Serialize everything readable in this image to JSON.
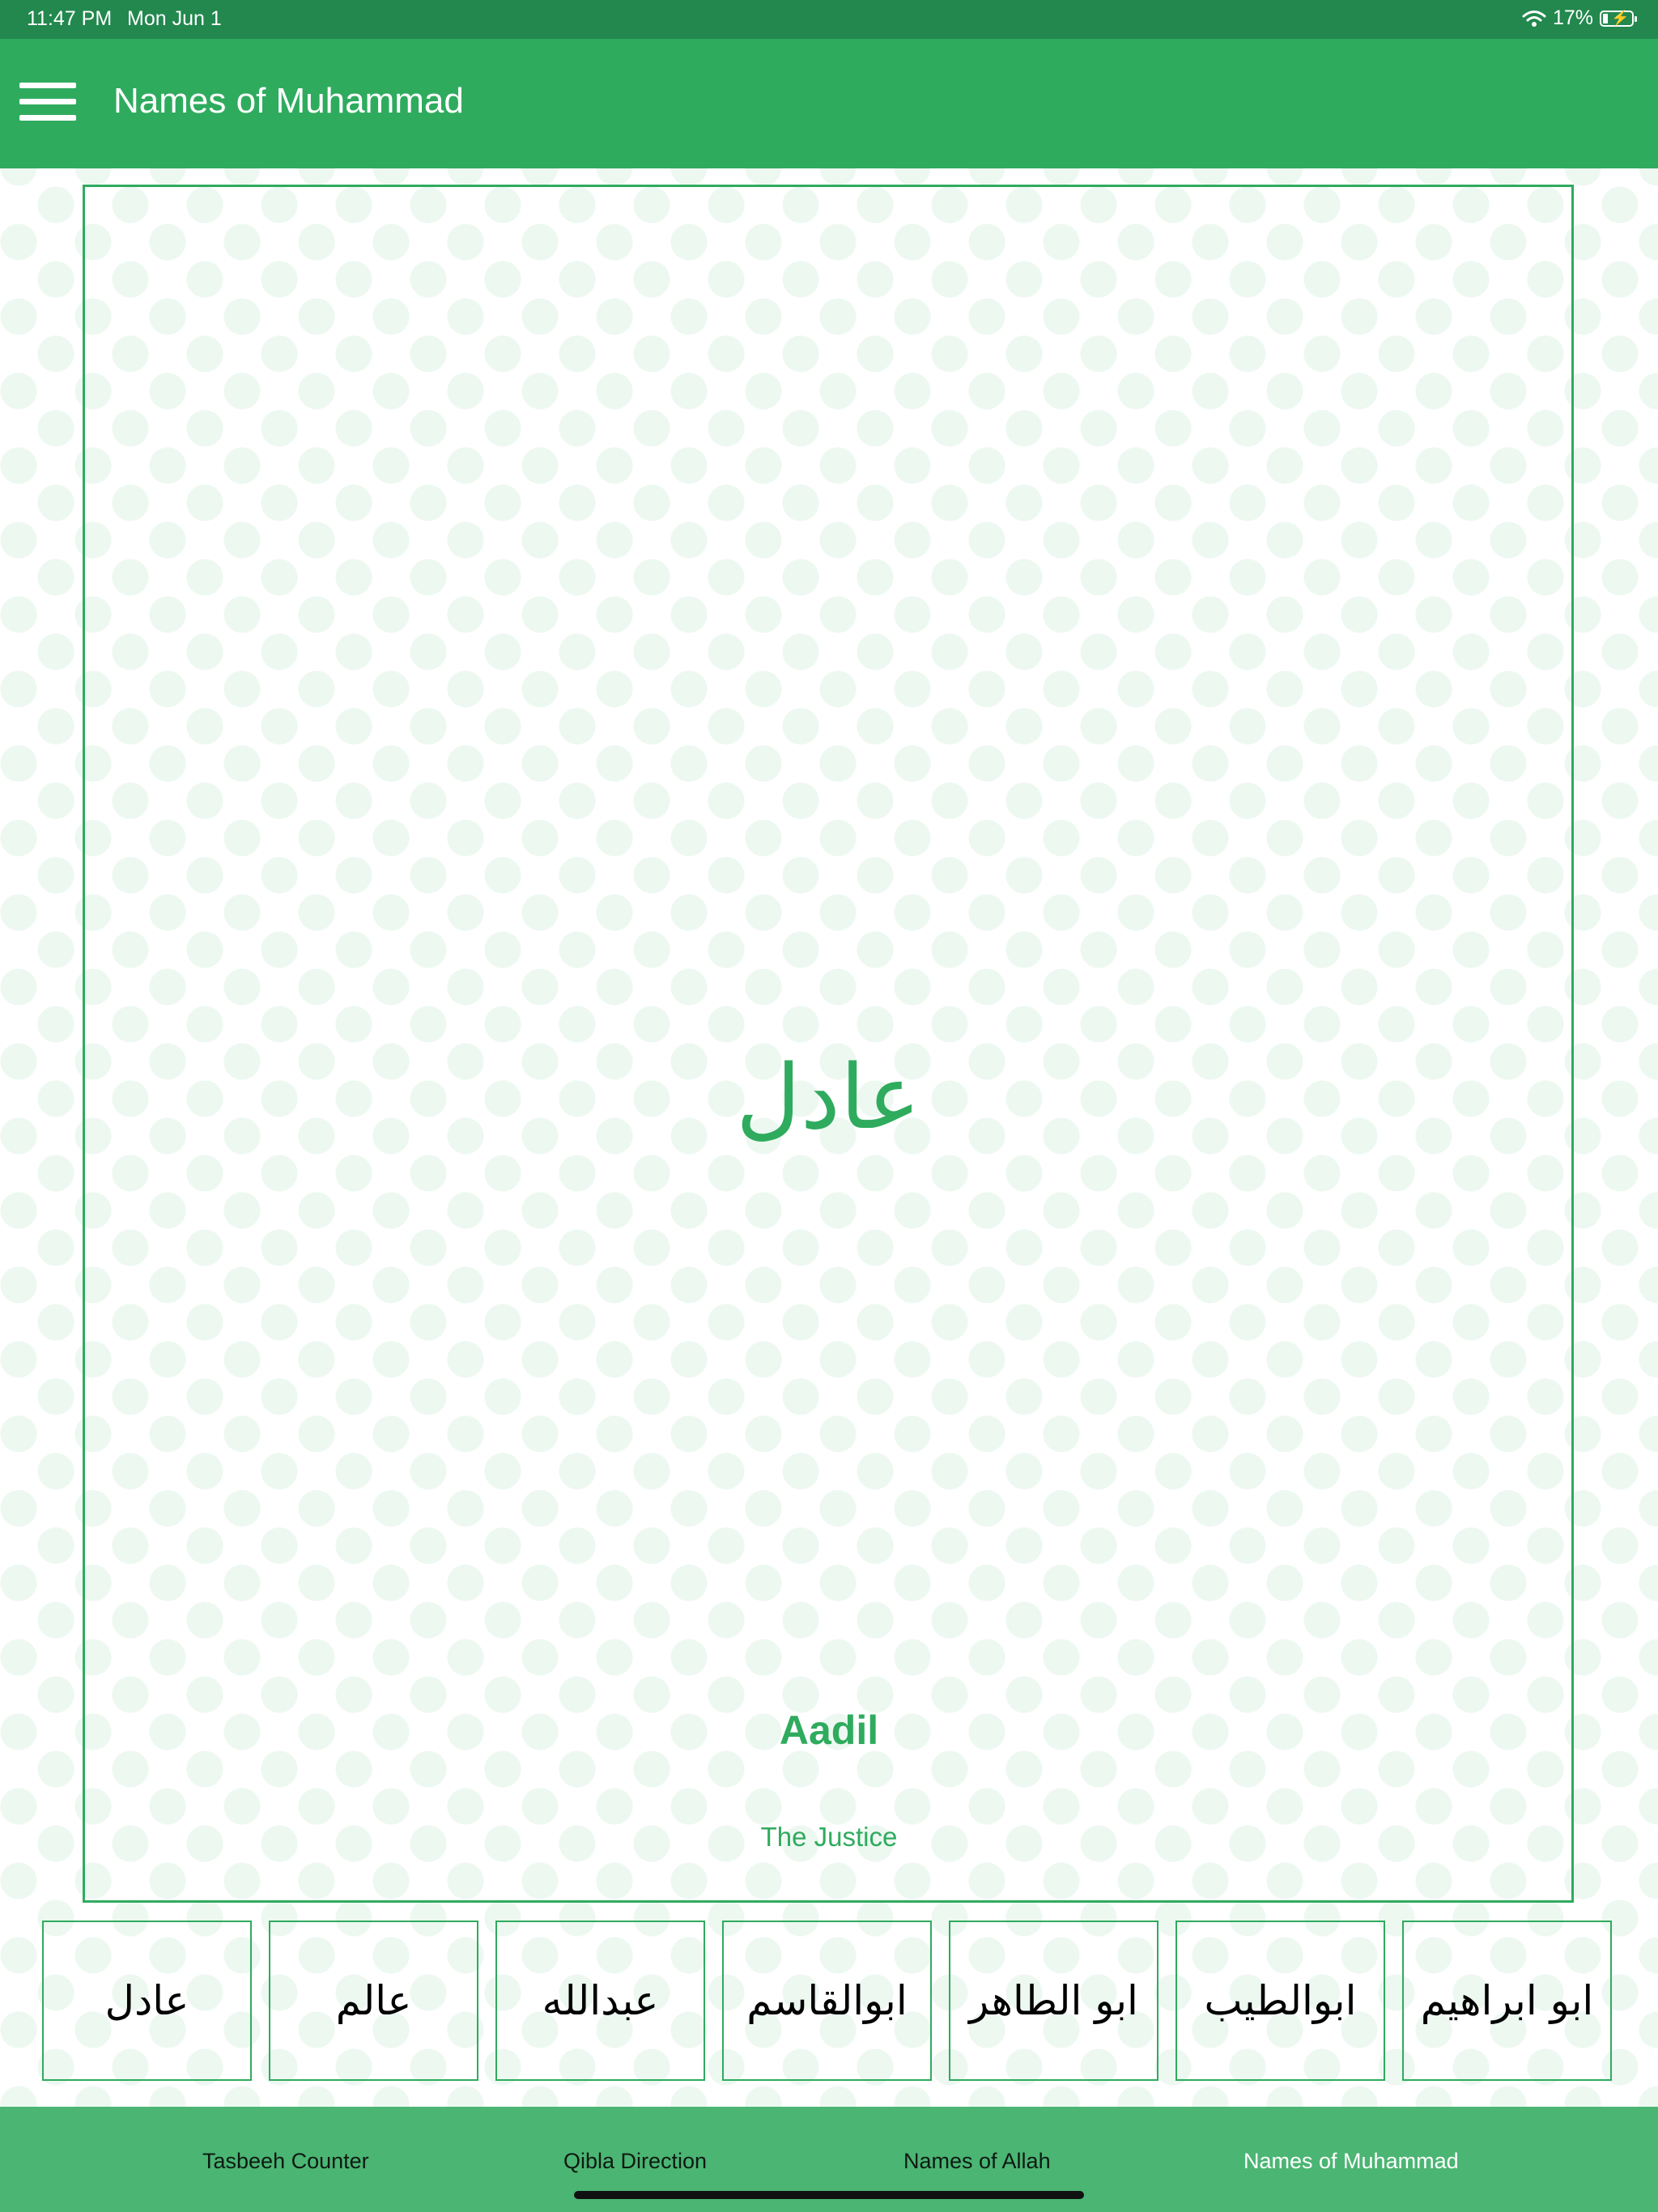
{
  "status_bar": {
    "time": "11:47 PM",
    "date": "Mon Jun 1",
    "battery_text": "17%",
    "battery_level": 0.17,
    "wifi_icon": "wifi-icon",
    "battery_icon": "battery-charging-icon"
  },
  "app_bar": {
    "title": "Names of Muhammad",
    "menu_icon": "hamburger-menu-icon"
  },
  "colors": {
    "primary": "#2fab5e",
    "status_bar": "#22884e",
    "tab_bar": "#4bb573"
  },
  "selected_name": {
    "arabic": "عادل",
    "transliteration": "Aadil",
    "meaning": "The Justice"
  },
  "name_list": [
    "عادل",
    "عالم",
    "عبدالله",
    "ابوالقاسم",
    "ابو الطاهر",
    "ابوالطیب",
    "ابو ابراهیم"
  ],
  "tabs": [
    {
      "label": "Tasbeeh Counter",
      "active": false
    },
    {
      "label": "Qibla Direction",
      "active": false
    },
    {
      "label": "Names of Allah",
      "active": false
    },
    {
      "label": "Names of Muhammad",
      "active": true
    }
  ]
}
